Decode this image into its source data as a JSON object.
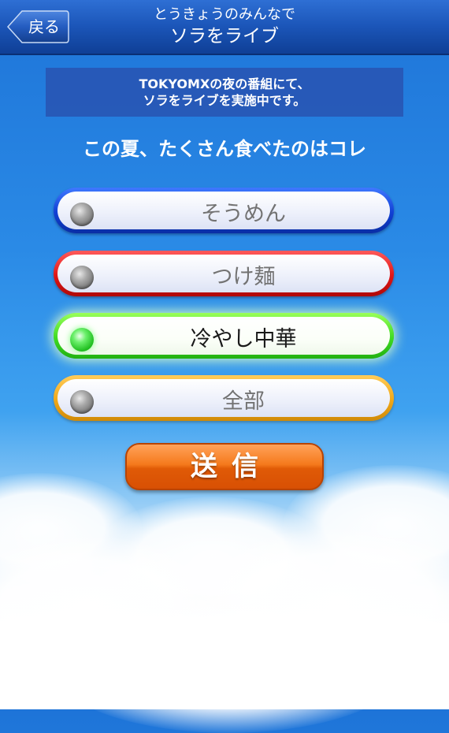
{
  "header": {
    "back_label": "戻る",
    "subtitle": "とうきょうのみんなで",
    "title": "ソラをライブ"
  },
  "notice": {
    "line1": "TOKYOMXの夜の番組にて、",
    "line2": "ソラをライブを実施中です。"
  },
  "question": "この夏、たくさん食べたのはコレ",
  "options": [
    {
      "label": "そうめん",
      "color": "#1040d4",
      "selected": false
    },
    {
      "label": "つけ麺",
      "color": "#e01616",
      "selected": false
    },
    {
      "label": "冷やし中華",
      "color": "#3fdb22",
      "selected": true
    },
    {
      "label": "全部",
      "color": "#f0a818",
      "selected": false
    }
  ],
  "submit_label": "送信",
  "colors": {
    "header": "#1b55b8",
    "sky": "#2a8ae6",
    "submit": "#f57a1c"
  }
}
